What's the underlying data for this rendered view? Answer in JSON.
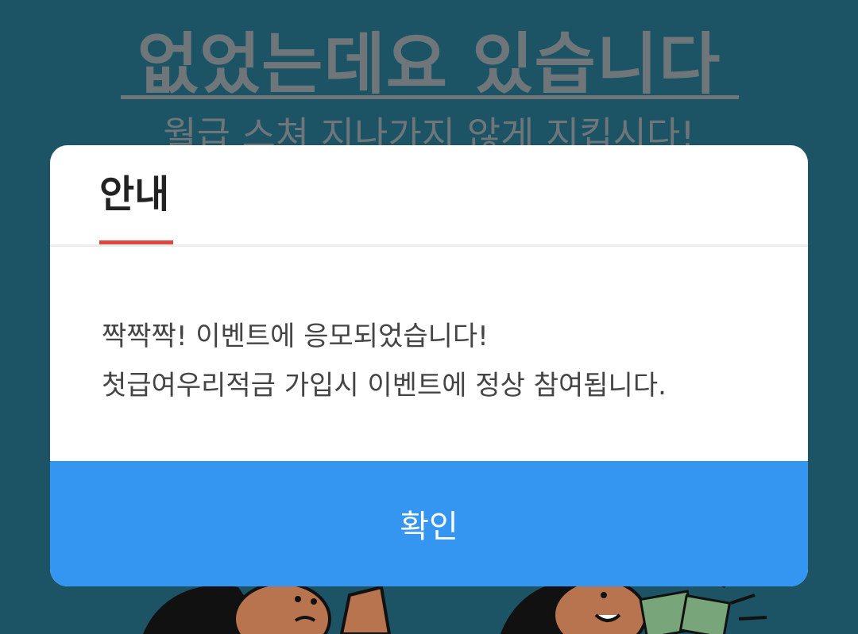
{
  "background": {
    "headline": "없었는데요 있습니다",
    "subline": "월급 스쳐 지나가지 않게 지킵시다!"
  },
  "modal": {
    "title": "안내",
    "message_lines": [
      "짝짝짝! 이벤트에 응모되었습니다!",
      "첫급여우리적금 가입시 이벤트에 정상 참여됩니다."
    ],
    "confirm_label": "확인"
  },
  "colors": {
    "accent_underline": "#e0463e",
    "confirm_button": "#3596f2",
    "background_teal": "#1c5365"
  }
}
